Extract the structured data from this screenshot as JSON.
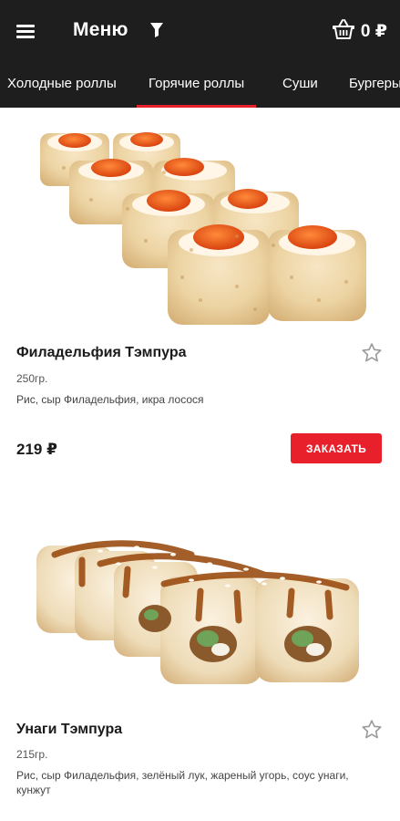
{
  "header": {
    "title": "Меню",
    "cart_count": "0 ₽",
    "menu_icon": "hamburger-menu-icon",
    "filter_icon": "filter-funnel-icon",
    "cart_icon": "shopping-basket-icon"
  },
  "tabs": [
    {
      "label": "Холодные роллы",
      "active": false
    },
    {
      "label": "Горячие роллы",
      "active": true
    },
    {
      "label": "Суши",
      "active": false
    },
    {
      "label": "Бургеры",
      "active": false
    }
  ],
  "products": [
    {
      "name": "Филадельфия Тэмпура",
      "weight": "250гр.",
      "description": "Рис, сыр Филадельфия, икра лосося",
      "price": "219 ₽",
      "order_label": "ЗАКАЗАТЬ",
      "favorite_icon": "star-outline-icon"
    },
    {
      "name": "Унаги Тэмпура",
      "weight": "215гр.",
      "description": "Рис, сыр Филадельфия, зелёный лук, жареный угорь, соус унаги, кунжут",
      "favorite_icon": "star-outline-icon"
    }
  ],
  "colors": {
    "header_bg": "#1e1e1e",
    "accent": "#e8202c",
    "text": "#1a1a1a"
  }
}
